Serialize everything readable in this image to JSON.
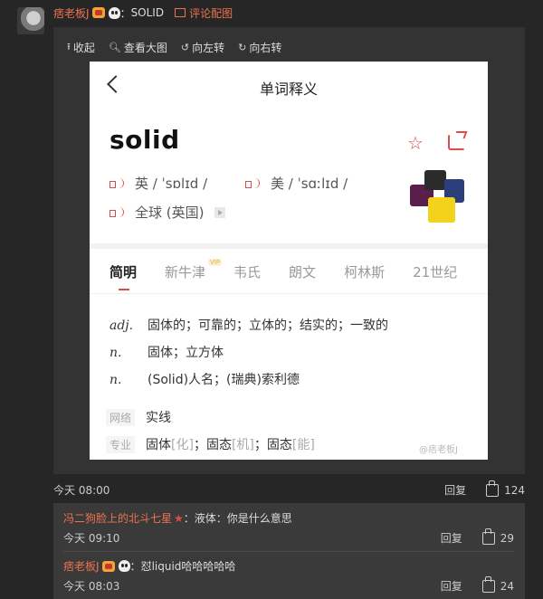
{
  "comment": {
    "username": "痞老板J",
    "colon": "：",
    "text": "SOLID",
    "pic_link": "评论配图",
    "time": "今天 08:00",
    "reply": "回复",
    "likes": "124"
  },
  "toolbar": {
    "collapse": "收起",
    "view_large": "查看大图",
    "rotate_left": "向左转",
    "rotate_right": "向右转"
  },
  "dict": {
    "header": "单词释义",
    "word": "solid",
    "uk": "英 / ˈsɒlɪd /",
    "us": "美 / ˈsɑːlɪd /",
    "global": "全球 (英国)",
    "tabs": [
      "简明",
      "新牛津",
      "韦氏",
      "朗文",
      "柯林斯",
      "21世纪"
    ],
    "vip": "VIP",
    "definitions": [
      {
        "pos": "adj.",
        "text": "固体的；可靠的；立体的；结实的；一致的"
      },
      {
        "pos": "n.",
        "text": "固体；立方体"
      },
      {
        "pos": "n.",
        "text": "(Solid)人名；(瑞典)索利德"
      }
    ],
    "network_tag": "网络",
    "network_text": "实线",
    "pro_tag": "专业",
    "pro_parts": [
      "固体",
      "[化]",
      "；固态",
      "[机]",
      "；固态",
      "[能]"
    ],
    "watermark": "@痞老板J"
  },
  "replies": [
    {
      "username": "冯二狗脸上的北斗七星",
      "colon": "：",
      "text": "液体：你是什么意思",
      "time": "今天 09:10",
      "reply": "回复",
      "likes": "29"
    },
    {
      "username": "痞老板J",
      "colon": "：",
      "text": "怼liquid哈哈哈哈哈",
      "time": "今天 08:03",
      "reply": "回复",
      "likes": "24"
    }
  ],
  "colors": {
    "accent": "#eb7350",
    "dict_red": "#e24a4a",
    "bg": "#262626",
    "panel": "#333333"
  }
}
